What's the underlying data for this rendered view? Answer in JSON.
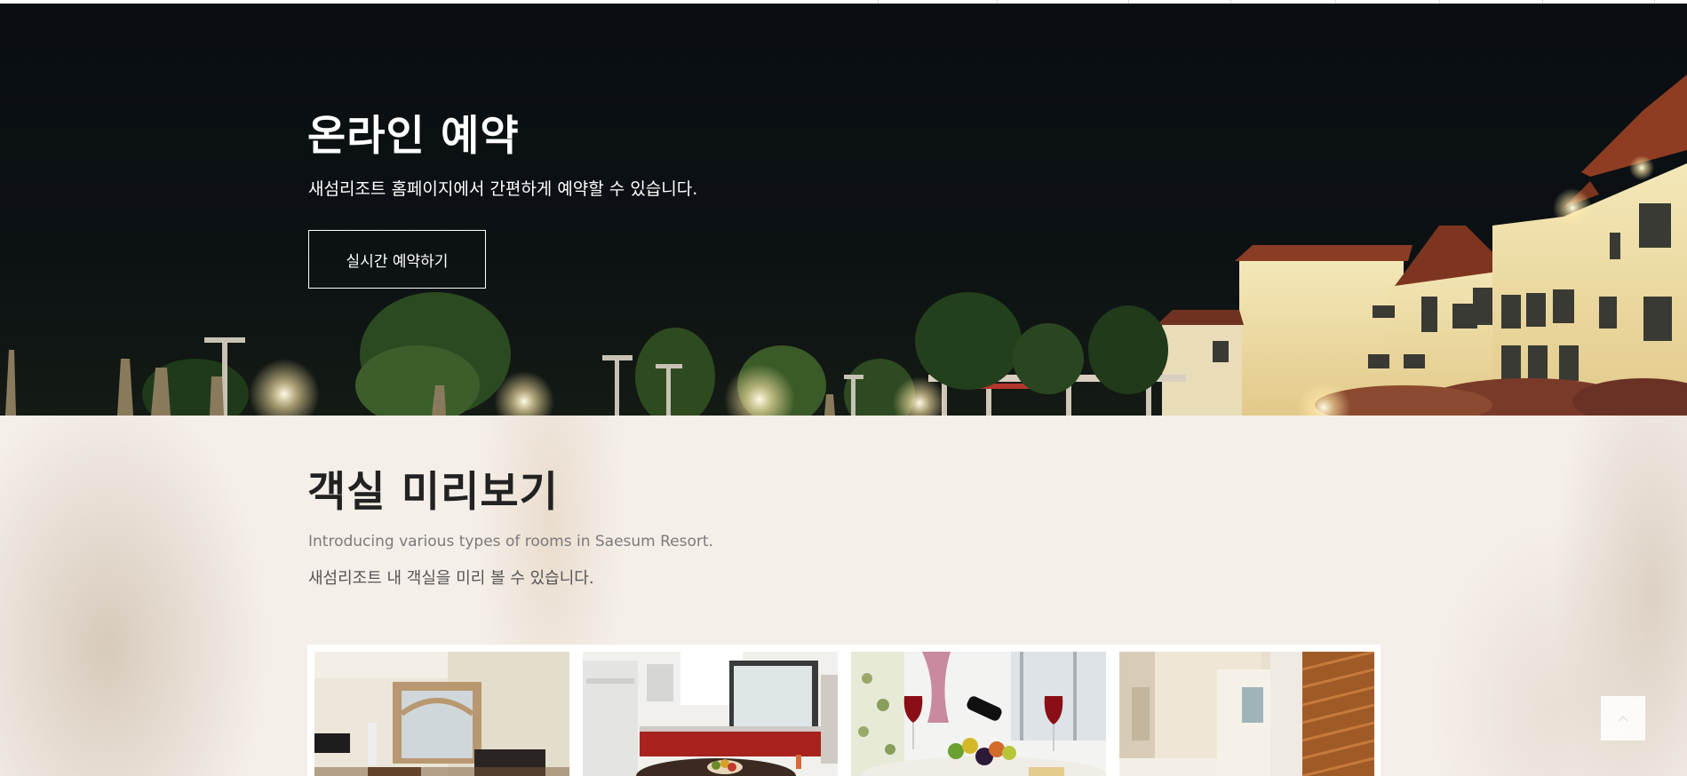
{
  "hero": {
    "title": "온라인 예약",
    "subtitle": "새섬리조트 홈페이지에서 간편하게 예약할 수 있습니다.",
    "button_label": "실시간 예약하기"
  },
  "rooms": {
    "title": "객실 미리보기",
    "subtitle_en": "Introducing various types of rooms in Saesum Resort.",
    "subtitle_ko": "새섬리조트 내 객실을 미리 볼 수 있습니다.",
    "thumbnails": [
      {
        "name": "living-room"
      },
      {
        "name": "kitchen"
      },
      {
        "name": "wine-table"
      },
      {
        "name": "bathroom"
      }
    ]
  }
}
